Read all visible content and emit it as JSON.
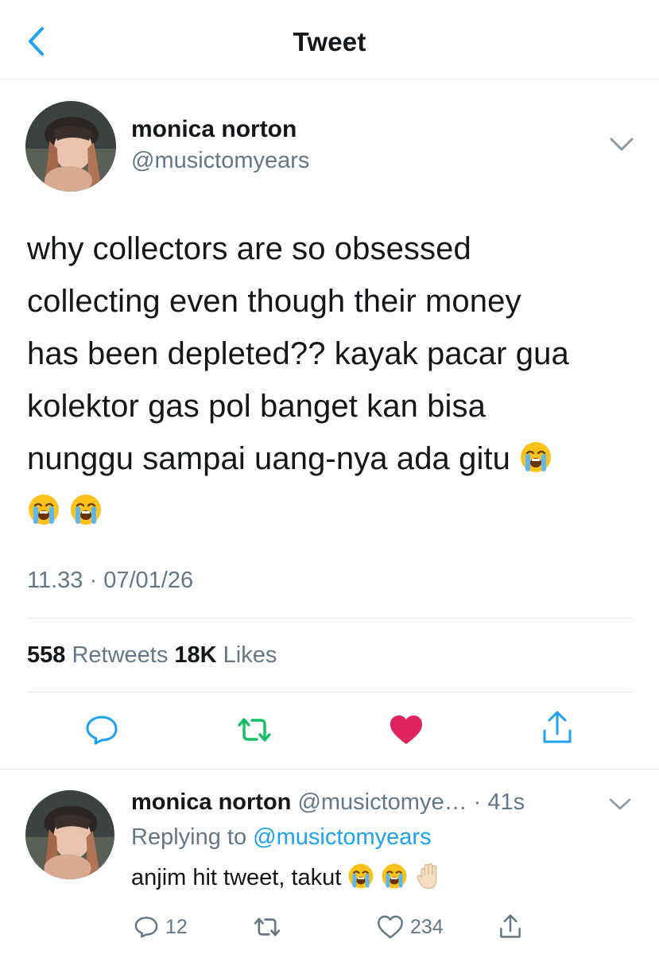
{
  "header": {
    "title": "Tweet",
    "back_icon": "chevron-left-icon"
  },
  "tweet": {
    "author_name": "monica norton",
    "author_handle": "@musictomyears",
    "text_lines": [
      "why collectors are so obsessed",
      "collecting even though their money",
      "has been depleted?? kayak pacar gua",
      "kolektor gas pol banget kan bisa",
      "nunggu sampai uang-nya ada gitu"
    ],
    "emoji": "loudly-crying-face",
    "timestamp": "11.33 · 07/01/26",
    "retweet_count": "558",
    "retweet_label": "Retweets",
    "like_count": "18K",
    "like_label": "Likes",
    "liked": true,
    "colors": {
      "retweet_green": "#17bf63",
      "like_red": "#e0245e",
      "link_blue": "#1da1f2",
      "icon_blue": "#1da1f2"
    }
  },
  "reply": {
    "author_name": "monica norton",
    "author_handle": "@musictomye…",
    "separator": " · ",
    "time": "41s",
    "replying_prefix": "Replying to",
    "replying_to": "@musictomyears",
    "text": "anjim hit tweet, takut",
    "emojis": [
      "loudly-crying-face",
      "loudly-crying-face",
      "raised-hand"
    ],
    "reply_count": "12",
    "like_count": "234"
  }
}
